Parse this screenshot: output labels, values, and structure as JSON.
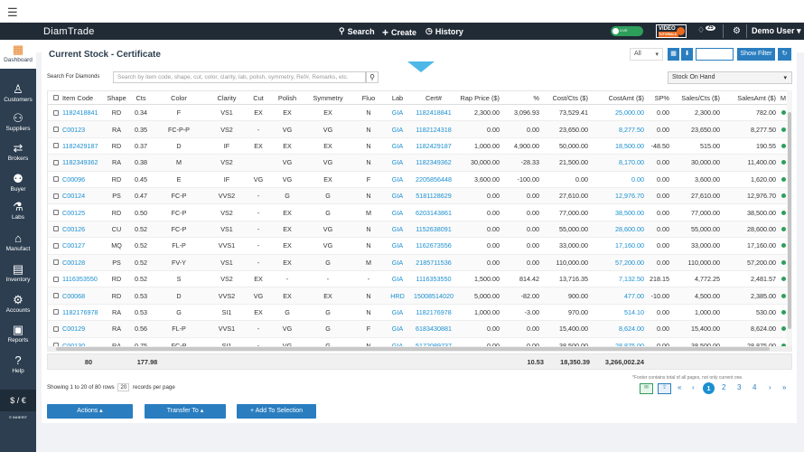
{
  "app": {
    "brand": "DiamTrade"
  },
  "nav": {
    "search": "Search",
    "create": "Create",
    "history": "History",
    "toggle": "LIVE",
    "video_line1": "VIDEO",
    "video_line2": "TUTORIALS",
    "notif_count": "25",
    "user": "Demo User"
  },
  "sidebar": [
    {
      "label": "Dashboard",
      "icon": "dashboard-icon",
      "glyph": "▦"
    },
    {
      "label": "Customers",
      "icon": "customer-icon",
      "glyph": "♙"
    },
    {
      "label": "Suppliers",
      "icon": "supplier-icon",
      "glyph": "⚇"
    },
    {
      "label": "Brokers",
      "icon": "handshake-icon",
      "glyph": "⇄"
    },
    {
      "label": "Buyer",
      "icon": "buyer-icon",
      "glyph": "⚉"
    },
    {
      "label": "Labs",
      "icon": "lab-icon",
      "glyph": "⚗"
    },
    {
      "label": "Manufact",
      "icon": "factory-icon",
      "glyph": "⌂"
    },
    {
      "label": "Inventory",
      "icon": "inventory-icon",
      "glyph": "▤"
    },
    {
      "label": "Accounts",
      "icon": "accounts-icon",
      "glyph": "⚙"
    },
    {
      "label": "Reports",
      "icon": "reports-icon",
      "glyph": "▣"
    },
    {
      "label": "Help",
      "icon": "help-icon",
      "glyph": "?"
    }
  ],
  "sidebar_extra": {
    "currency": "$ / €",
    "footer": "© INHERIT"
  },
  "page": {
    "title": "Current Stock - Certificate",
    "filter_select": "All",
    "show_filter": "Show Filter"
  },
  "search": {
    "label": "Search For Diamonds",
    "placeholder": "Search by item code, shape, cut, color, clarity, lab, polish, symmetry, Ref#, Remarks, etc.",
    "stock_select": "Stock On Hand"
  },
  "table": {
    "headers": [
      "Item Code",
      "Shape",
      "Cts",
      "Color",
      "Clarity",
      "Cut",
      "Polish",
      "Symmetry",
      "Fluo",
      "Lab",
      "Cert#",
      "Rap Price ($)",
      "%",
      "Cost/Cts ($)",
      "CostAmt ($)",
      "SP%",
      "Sales/Cts ($)",
      "SalesAmt ($)",
      "M"
    ],
    "rows": [
      [
        "1182418841",
        "RD",
        "0.34",
        "F",
        "VS1",
        "EX",
        "EX",
        "EX",
        "N",
        "GIA",
        "1182418841",
        "2,300.00",
        "3,096.93",
        "73,529.41",
        "25,000.00",
        "0.00",
        "2,300.00",
        "782.00"
      ],
      [
        "C00123",
        "RA",
        "0.35",
        "FC-P-P",
        "VS2",
        "-",
        "VG",
        "VG",
        "N",
        "GIA",
        "1182124318",
        "0.00",
        "0.00",
        "23,650.00",
        "8,277.50",
        "0.00",
        "23,650.00",
        "8,277.50"
      ],
      [
        "1182429187",
        "RD",
        "0.37",
        "D",
        "IF",
        "EX",
        "EX",
        "EX",
        "N",
        "GIA",
        "1182429187",
        "1,000.00",
        "4,900.00",
        "50,000.00",
        "18,500.00",
        "-48.50",
        "515.00",
        "190.55"
      ],
      [
        "1182349362",
        "RA",
        "0.38",
        "M",
        "VS2",
        "",
        "VG",
        "VG",
        "N",
        "GIA",
        "1182349362",
        "30,000.00",
        "-28.33",
        "21,500.00",
        "8,170.00",
        "0.00",
        "30,000.00",
        "11,400.00"
      ],
      [
        "C00096",
        "RD",
        "0.45",
        "E",
        "IF",
        "VG",
        "VG",
        "EX",
        "F",
        "GIA",
        "2205856448",
        "3,600.00",
        "-100.00",
        "0.00",
        "0.00",
        "0.00",
        "3,600.00",
        "1,620.00"
      ],
      [
        "C00124",
        "PS",
        "0.47",
        "FC-P",
        "VVS2",
        "-",
        "G",
        "G",
        "N",
        "GIA",
        "5181128629",
        "0.00",
        "0.00",
        "27,610.00",
        "12,976.70",
        "0.00",
        "27,610.00",
        "12,976.70"
      ],
      [
        "C00125",
        "RD",
        "0.50",
        "FC-P",
        "VS2",
        "-",
        "EX",
        "G",
        "M",
        "GIA",
        "6203143861",
        "0.00",
        "0.00",
        "77,000.00",
        "38,500.00",
        "0.00",
        "77,000.00",
        "38,500.00"
      ],
      [
        "C00126",
        "CU",
        "0.52",
        "FC-P",
        "VS1",
        "-",
        "EX",
        "VG",
        "N",
        "GIA",
        "1152638091",
        "0.00",
        "0.00",
        "55,000.00",
        "28,600.00",
        "0.00",
        "55,000.00",
        "28,600.00"
      ],
      [
        "C00127",
        "MQ",
        "0.52",
        "FL-P",
        "VVS1",
        "-",
        "EX",
        "VG",
        "N",
        "GIA",
        "1162673556",
        "0.00",
        "0.00",
        "33,000.00",
        "17,160.00",
        "0.00",
        "33,000.00",
        "17,160.00"
      ],
      [
        "C00128",
        "PS",
        "0.52",
        "FV-Y",
        "VS1",
        "-",
        "EX",
        "G",
        "M",
        "GIA",
        "2185711536",
        "0.00",
        "0.00",
        "110,000.00",
        "57,200.00",
        "0.00",
        "110,000.00",
        "57,200.00"
      ],
      [
        "1116353550",
        "RD",
        "0.52",
        "S",
        "VS2",
        "EX",
        "-",
        "-",
        "-",
        "GIA",
        "1116353550",
        "1,500.00",
        "814.42",
        "13,716.35",
        "7,132.50",
        "218.15",
        "4,772.25",
        "2,481.57"
      ],
      [
        "C00068",
        "RD",
        "0.53",
        "D",
        "VVS2",
        "VG",
        "EX",
        "EX",
        "N",
        "HRD",
        "15008514020",
        "5,000.00",
        "-82.00",
        "900.00",
        "477.00",
        "-10.00",
        "4,500.00",
        "2,385.00"
      ],
      [
        "1182176978",
        "RA",
        "0.53",
        "G",
        "SI1",
        "EX",
        "G",
        "G",
        "N",
        "GIA",
        "1182176978",
        "1,000.00",
        "-3.00",
        "970.00",
        "514.10",
        "0.00",
        "1,000.00",
        "530.00"
      ],
      [
        "C00129",
        "RA",
        "0.56",
        "FL-P",
        "VVS1",
        "-",
        "VG",
        "G",
        "F",
        "GIA",
        "6183430881",
        "0.00",
        "0.00",
        "15,400.00",
        "8,624.00",
        "0.00",
        "15,400.00",
        "8,624.00"
      ],
      [
        "C00130",
        "RA",
        "0.75",
        "FC-P",
        "SI1",
        "-",
        "VG",
        "G",
        "N",
        "GIA",
        "5172089737",
        "0.00",
        "0.00",
        "38,500.00",
        "28,875.00",
        "0.00",
        "38,500.00",
        "28,875.00"
      ]
    ],
    "footer": {
      "count": "80",
      "cts": "177.98",
      "pct": "10.53",
      "cost_cts": "18,350.39",
      "cost_amt": "3,266,002.24"
    }
  },
  "footer_note": "*Footer contains total of all pages, not only current one.",
  "paging": {
    "showing_pre": "Showing 1 to 20 of 80 rows",
    "page_size": "20",
    "showing_post": "records per page",
    "pages": [
      "1",
      "2",
      "3",
      "4"
    ],
    "current": "1"
  },
  "actions": {
    "actions": "Actions ▴",
    "transfer": "Transfer To ▴",
    "add": "+ Add To Selection"
  },
  "colors": {
    "accent": "#2a7ec0",
    "link": "#1a8fd0",
    "sidebar": "#2c3e50",
    "topbar": "#212b36",
    "success": "#2e9e5b"
  }
}
